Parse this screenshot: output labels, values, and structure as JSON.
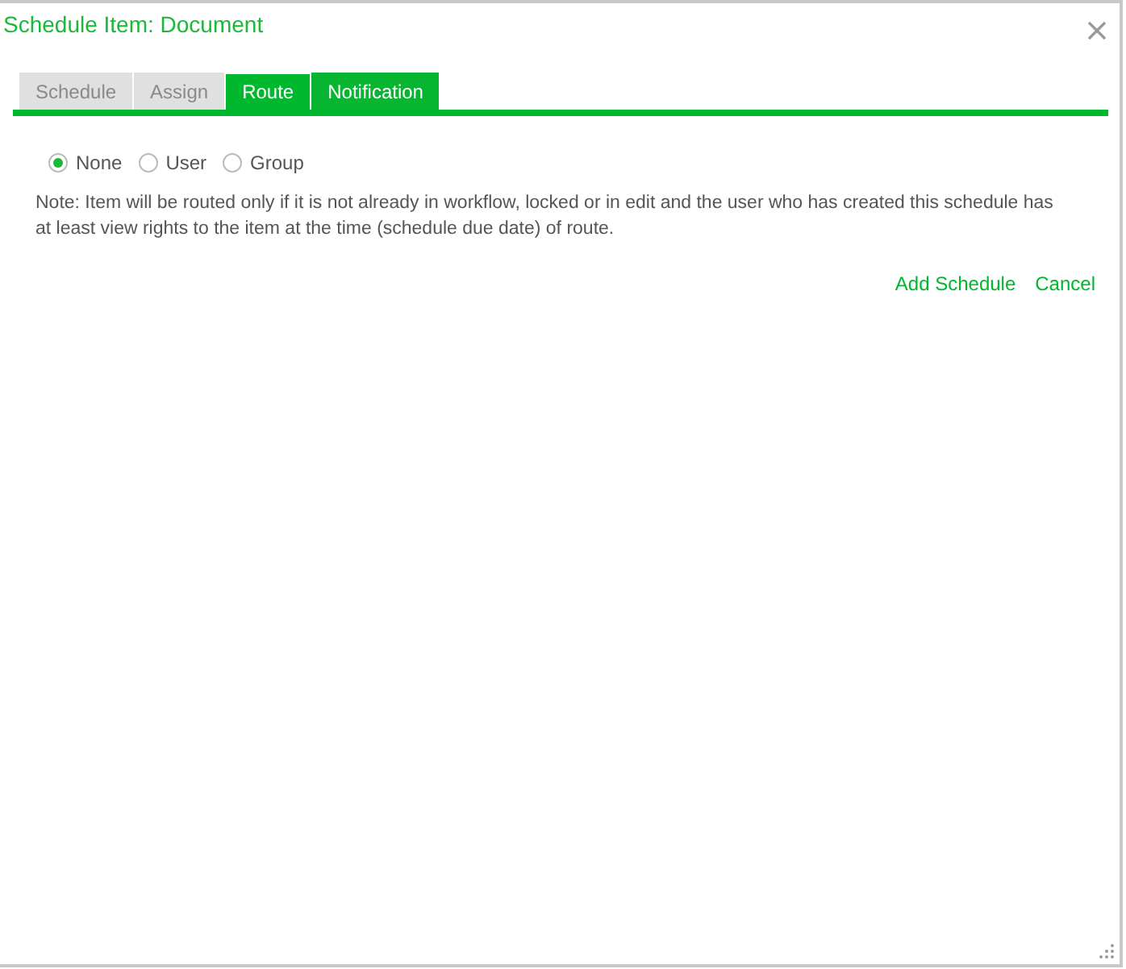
{
  "window": {
    "title": "Schedule Item: Document"
  },
  "tabs": [
    {
      "label": "Schedule",
      "selected": false,
      "hovered": false
    },
    {
      "label": "Assign",
      "selected": false,
      "hovered": false
    },
    {
      "label": "Route",
      "selected": true,
      "hovered": false
    },
    {
      "label": "Notification",
      "selected": false,
      "hovered": true
    }
  ],
  "route_options": [
    {
      "label": "None",
      "selected": true
    },
    {
      "label": "User",
      "selected": false
    },
    {
      "label": "Group",
      "selected": false
    }
  ],
  "note": "Note: Item will be routed only if it is not already in workflow, locked or in edit and the user who has created this schedule has at least view rights to the item at the time (schedule due date) of route.",
  "actions": [
    "Add Schedule",
    "Cancel"
  ]
}
